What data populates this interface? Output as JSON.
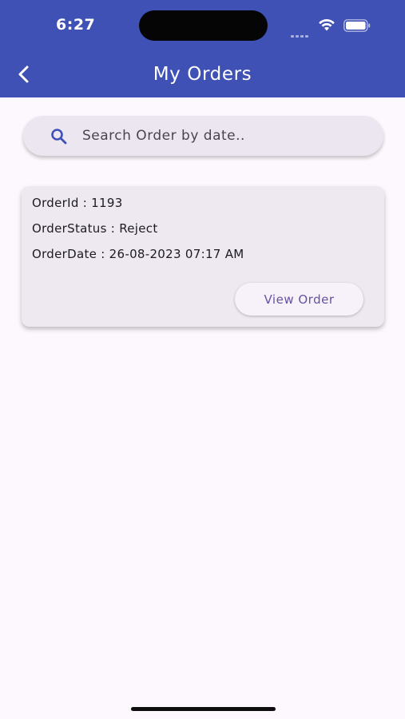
{
  "status_bar": {
    "time": "6:27",
    "icons": [
      "signal-icon",
      "wifi-icon",
      "battery-icon"
    ]
  },
  "app_bar": {
    "title": "My Orders",
    "back_icon": "chevron-left-icon",
    "background": "#3f51b5"
  },
  "search": {
    "placeholder": "Search Order by date..",
    "value": "",
    "icon": "search-icon"
  },
  "orders": [
    {
      "order_id_line": "OrderId : 1193",
      "status_line": "OrderStatus : Reject",
      "date_line": "OrderDate : 26-08-2023 07:17 AM",
      "action_label": "View Order"
    }
  ],
  "colors": {
    "accent": "#3f51b5",
    "button_text": "#6750a4",
    "card_bg": "#eee9f1",
    "page_bg": "#fcf8fd"
  }
}
